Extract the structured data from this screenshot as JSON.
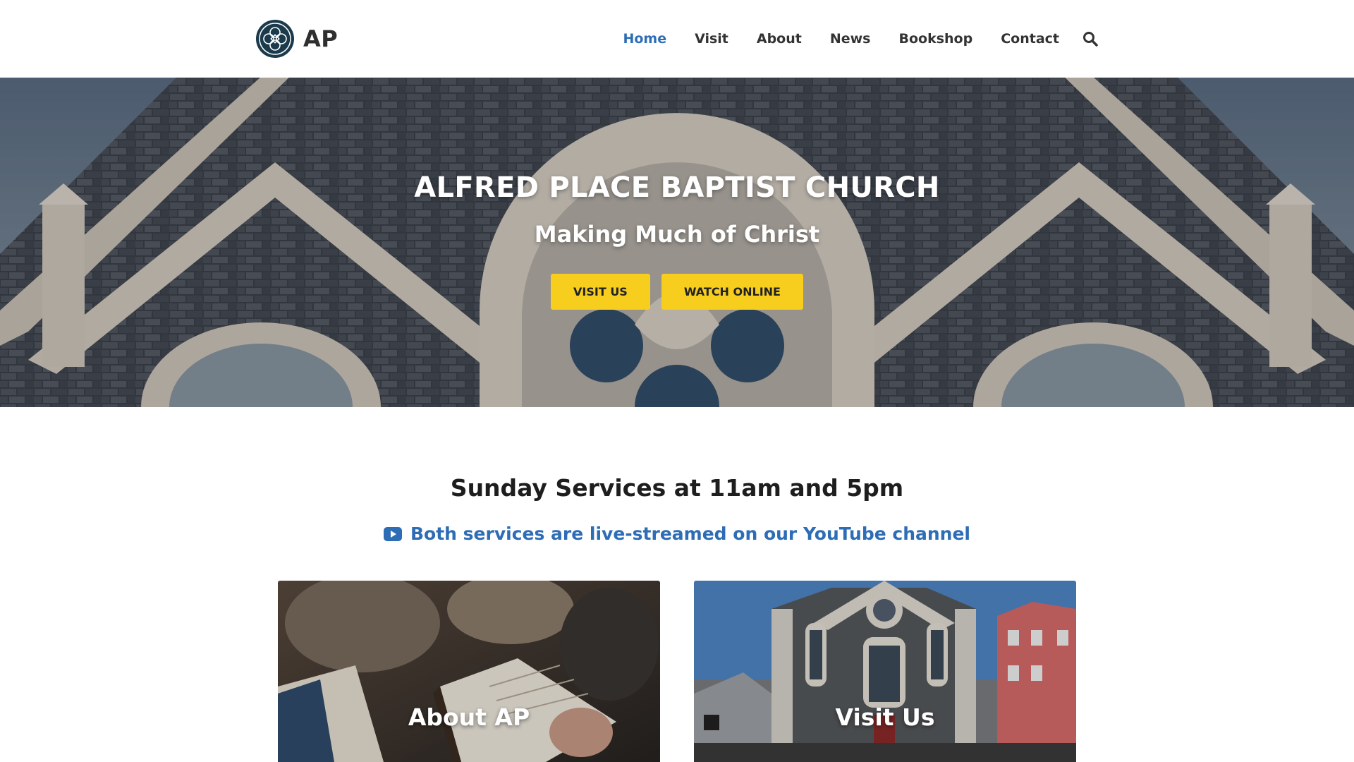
{
  "site": {
    "logo_text": "AP",
    "colors": {
      "accent": "#2d6db5",
      "button": "#f7cd1e",
      "logo_dark": "#1b3a4b"
    }
  },
  "nav": {
    "items": [
      {
        "label": "Home",
        "active": true
      },
      {
        "label": "Visit",
        "active": false
      },
      {
        "label": "About",
        "active": false
      },
      {
        "label": "News",
        "active": false
      },
      {
        "label": "Bookshop",
        "active": false
      },
      {
        "label": "Contact",
        "active": false
      }
    ],
    "search_icon": "search-icon"
  },
  "hero": {
    "title": "ALFRED PLACE BAPTIST CHURCH",
    "subtitle": "Making Much of Christ",
    "buttons": {
      "visit": "VISIT US",
      "watch": "WATCH ONLINE"
    }
  },
  "services": {
    "title": "Sunday Services at 11am and 5pm",
    "stream_text": "Both services are live-streamed on our YouTube channel",
    "stream_icon": "youtube-icon"
  },
  "cards": {
    "about": {
      "label": "About AP"
    },
    "visit": {
      "label": "Visit Us"
    }
  }
}
